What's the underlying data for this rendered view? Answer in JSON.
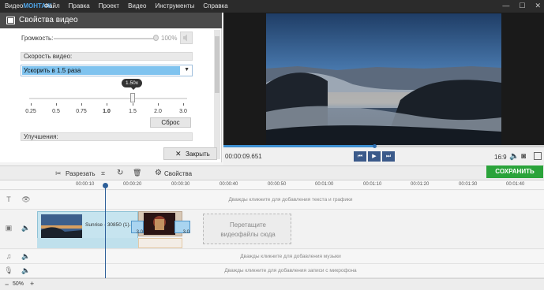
{
  "app": {
    "logo_prefix": "Видео",
    "logo_suffix": "МОНТАЖ"
  },
  "menu": [
    "Файл",
    "Правка",
    "Проект",
    "Видео",
    "Инструменты",
    "Справка"
  ],
  "window_controls": [
    "—",
    "☐",
    "✕"
  ],
  "properties": {
    "title": "Свойства видео",
    "volume_label": "Громкость:",
    "volume_value": "100%",
    "volume_level": 1.0,
    "speed_section": "Скорость видео:",
    "speed_selected": "Ускорить в 1.5 раза",
    "speed_tooltip": "1.50x",
    "speed_ticks": [
      "0.25",
      "0.5",
      "0.75",
      "1.0",
      "1.5",
      "2.0",
      "3.0"
    ],
    "reset_label": "Сброс",
    "improvements_section": "Улучшения:",
    "close_label": "Закрыть"
  },
  "player": {
    "timecode": "00:00:09.651",
    "progress": 0.47,
    "aspect": "16:9",
    "save_label": "СОХРАНИТЬ ВИДЕО"
  },
  "toolbar": {
    "cut_label": "Разрезать",
    "props_label": "Свойства"
  },
  "ruler": [
    "00:00:10",
    "00:00:20",
    "00:00:30",
    "00:00:40",
    "00:00:50",
    "00:01:00",
    "00:01:10",
    "00:01:20",
    "00:01:30",
    "00:01:40"
  ],
  "timeline": {
    "text_hint": "Дважды кликните для добавления текста и графики",
    "clip1_label": "Sunrise - 30850 (1).m",
    "clip_badge": "3.0",
    "drop_hint_line1": "Перетащите",
    "drop_hint_line2": "видеофайлы сюда",
    "music_hint": "Дважды кликните для добавления музыки",
    "mic_hint": "Дважды кликните для добавления записи с микрофона"
  },
  "zoom": {
    "minus": "−",
    "value": "50%",
    "plus": "+"
  }
}
